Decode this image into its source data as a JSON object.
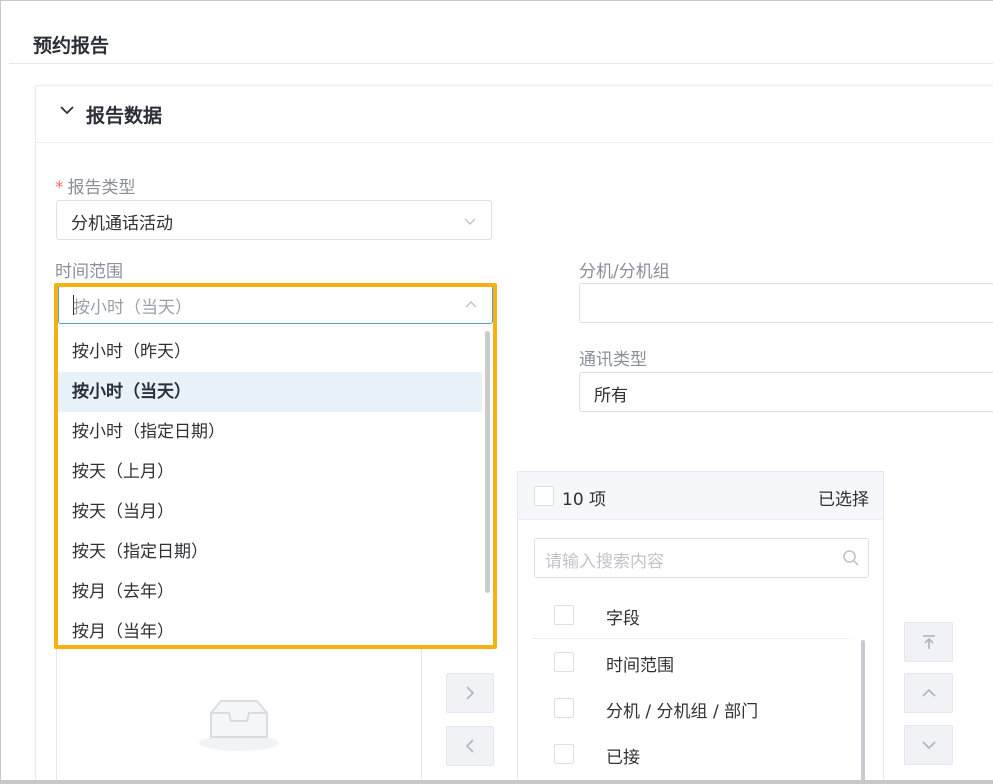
{
  "page": {
    "title": "预约报告"
  },
  "section": {
    "title": "报告数据"
  },
  "report_type": {
    "required_mark": "*",
    "label": "报告类型",
    "value": "分机通话活动"
  },
  "time_range": {
    "label": "时间范围",
    "value": "按小时（当天）",
    "options": [
      "按小时（昨天）",
      "按小时（当天）",
      "按小时（指定日期）",
      "按天（上月）",
      "按天（当月）",
      "按天（指定日期）",
      "按月（去年）",
      "按月（当年）"
    ],
    "selected_index": 1
  },
  "extension": {
    "label": "分机/分机组",
    "value": ""
  },
  "comm_type": {
    "label": "通讯类型",
    "value": "所有"
  },
  "transfer": {
    "right": {
      "count_label": "10 项",
      "selected_label": "已选择",
      "search_placeholder": "请输入搜索内容",
      "rows": [
        "字段",
        "时间范围",
        "分机 / 分机组 / 部门",
        "已接"
      ]
    }
  },
  "accent_colors": {
    "highlight": "#f3b20f",
    "active_option_bg": "#e8f2fb"
  }
}
